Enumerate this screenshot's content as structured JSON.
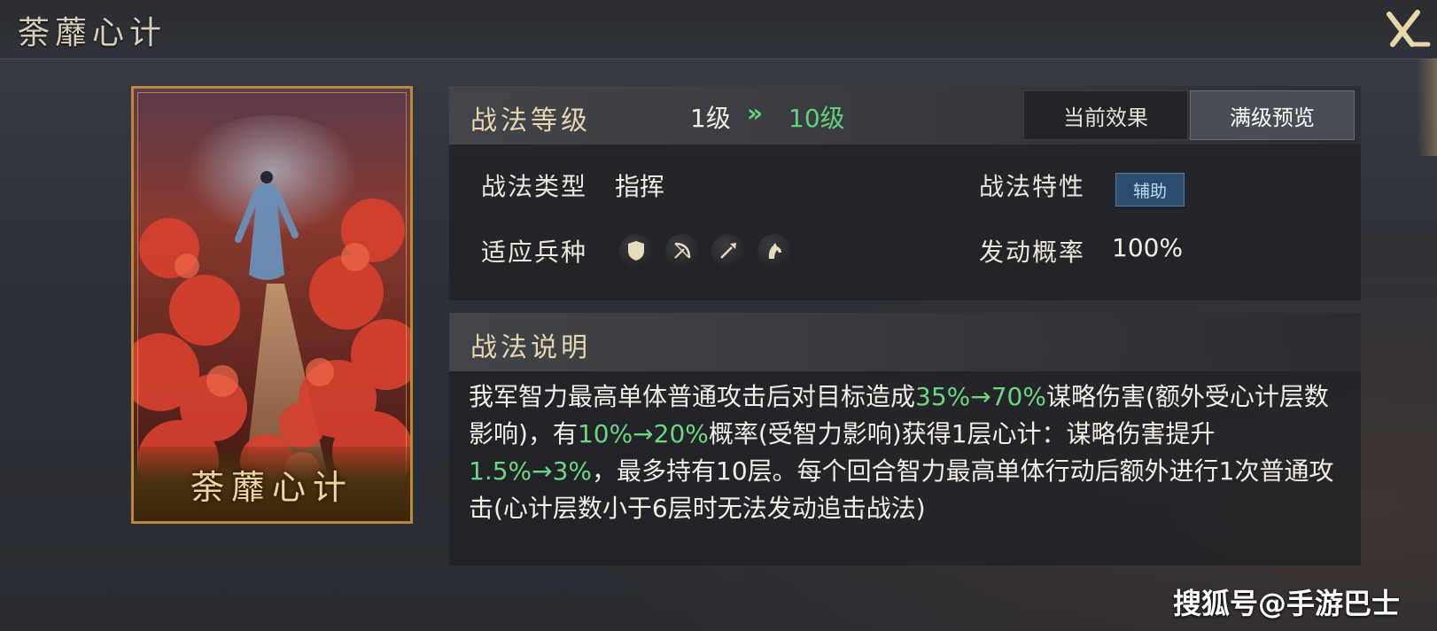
{
  "header": {
    "title": "荼蘼心计"
  },
  "card": {
    "name": "荼蘼心计"
  },
  "level": {
    "label": "战法等级",
    "from": "1级",
    "arrow": "»",
    "to": "10级"
  },
  "tabs": [
    {
      "label": "当前效果",
      "active": false
    },
    {
      "label": "满级预览",
      "active": true
    }
  ],
  "info": {
    "type_label": "战法类型",
    "type_value": "指挥",
    "trait_label": "战法特性",
    "trait_value": "辅助",
    "units_label": "适应兵种",
    "units": [
      "shield-icon",
      "bow-icon",
      "spear-icon",
      "horse-icon"
    ],
    "rate_label": "发动概率",
    "rate_value": "100%"
  },
  "description": {
    "label": "战法说明",
    "segments": [
      {
        "text": "我军智力最高单体普通攻击后对目标造成",
        "highlight": false
      },
      {
        "text": "35%→70%",
        "highlight": true
      },
      {
        "text": "谋略伤害(额外受心计层数影响)，有",
        "highlight": false
      },
      {
        "text": "10%→20%",
        "highlight": true
      },
      {
        "text": "概率(受智力影响)获得1层心计：谋略伤害提升",
        "highlight": false
      },
      {
        "text": "1.5%→3%",
        "highlight": true
      },
      {
        "text": "，最多持有10层。每个回合智力最高单体行动后额外进行1次普通攻击(心计层数小于6层时无法发动追击战法)",
        "highlight": false
      }
    ]
  },
  "watermark": "搜狐号@手游巴士",
  "colors": {
    "highlight": "#6ad87e",
    "card_border": "#b88a3a",
    "badge_bg": "#2c4d6e"
  }
}
